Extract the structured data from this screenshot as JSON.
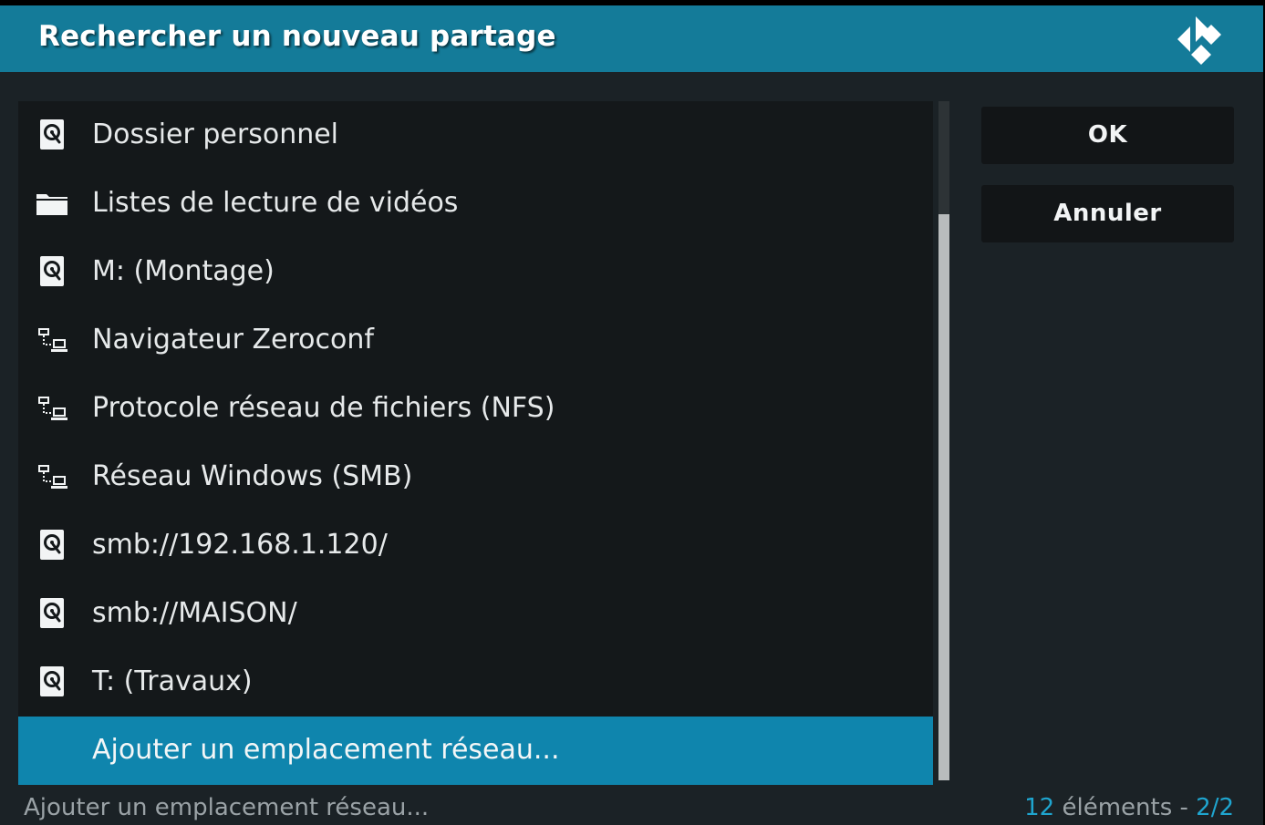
{
  "dialog": {
    "title": "Rechercher un nouveau partage"
  },
  "list": {
    "items": [
      {
        "label": "Dossier personnel",
        "icon": "harddisk-icon",
        "selected": false
      },
      {
        "label": "Listes de lecture de vidéos",
        "icon": "folder-icon",
        "selected": false
      },
      {
        "label": "M: (Montage)",
        "icon": "harddisk-icon",
        "selected": false
      },
      {
        "label": "Navigateur Zeroconf",
        "icon": "network-icon",
        "selected": false
      },
      {
        "label": "Protocole réseau de fichiers (NFS)",
        "icon": "network-icon",
        "selected": false
      },
      {
        "label": "Réseau Windows (SMB)",
        "icon": "network-icon",
        "selected": false
      },
      {
        "label": "smb://192.168.1.120/",
        "icon": "harddisk-icon",
        "selected": false
      },
      {
        "label": "smb://MAISON/",
        "icon": "harddisk-icon",
        "selected": false
      },
      {
        "label": "T: (Travaux)",
        "icon": "harddisk-icon",
        "selected": false
      },
      {
        "label": "Ajouter un emplacement réseau...",
        "icon": "",
        "selected": true
      }
    ]
  },
  "buttons": {
    "ok_label": "OK",
    "cancel_label": "Annuler"
  },
  "footer": {
    "status": "Ajouter un emplacement réseau...",
    "count": "12",
    "count_suffix": " éléments - ",
    "page": "2/2"
  },
  "colors": {
    "accent": "#147b99",
    "selected_row": "#0f85ad",
    "count_accent": "#1fa5cf",
    "background": "#1b2226"
  }
}
